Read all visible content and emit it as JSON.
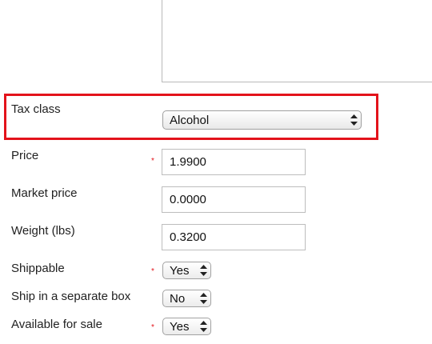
{
  "tax_class": {
    "label": "Tax class",
    "value": "Alcohol"
  },
  "price": {
    "label": "Price",
    "required_mark": "*",
    "value": "1.9900"
  },
  "market_price": {
    "label": "Market price",
    "value": "0.0000"
  },
  "weight": {
    "label": "Weight (lbs)",
    "value": "0.3200"
  },
  "shippable": {
    "label": "Shippable",
    "required_mark": "*",
    "value": "Yes"
  },
  "separate_box": {
    "label": "Ship in a separate box",
    "value": "No"
  },
  "available": {
    "label": "Available for sale",
    "required_mark": "*",
    "value": "Yes"
  },
  "colors": {
    "highlight": "#e3131b",
    "required": "#e3131b"
  }
}
